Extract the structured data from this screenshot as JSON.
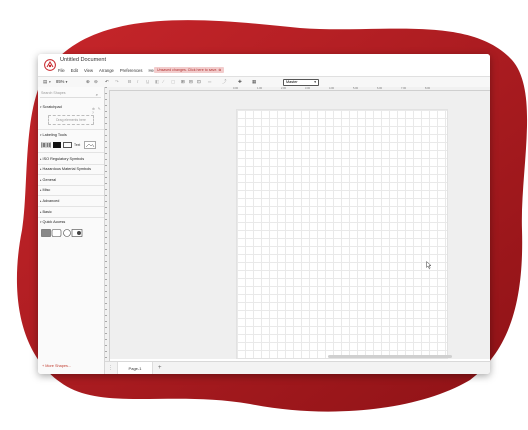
{
  "app": {
    "document_title": "Untitled Document",
    "unsaved_notice": "Unsaved changes. Click here to save.",
    "unsaved_close": "⊗"
  },
  "menu": {
    "items": [
      "File",
      "Edit",
      "View",
      "Arrange",
      "Preferences",
      "Help"
    ]
  },
  "toolbar": {
    "zoom": "85%",
    "page_select": "Master",
    "chevron": "▾"
  },
  "sidebar": {
    "search_placeholder": "Search Shapes",
    "scratchpad_label": "Scratchpad",
    "scratchpad_icons": "⊕ ✎ ?",
    "drop_hint": "Drag elements here",
    "sections": {
      "labeling_tools": "Labeling Tools",
      "iso_symbols": "ISO Regulatory Symbols",
      "hazardous": "Hazardous Material Symbols",
      "general": "General",
      "misc": "Misc",
      "advanced": "Advanced",
      "basic": "Basic",
      "quick_access": "Quick Access"
    },
    "text_shape_label": "Text",
    "more_shapes": "+ More Shapes..."
  },
  "ruler": {
    "labels": [
      "0.00",
      "1.00",
      "2.00",
      "3.00",
      "4.00",
      "5.00",
      "6.00",
      "7.00",
      "8.00"
    ]
  },
  "pages": {
    "tab_label": "Page-1",
    "menu_icon": "⋮",
    "add_label": "+"
  },
  "colors": {
    "brand_red": "#b11d22",
    "unsaved_bg": "#f2cccc",
    "more_shapes": "#c0392b"
  }
}
